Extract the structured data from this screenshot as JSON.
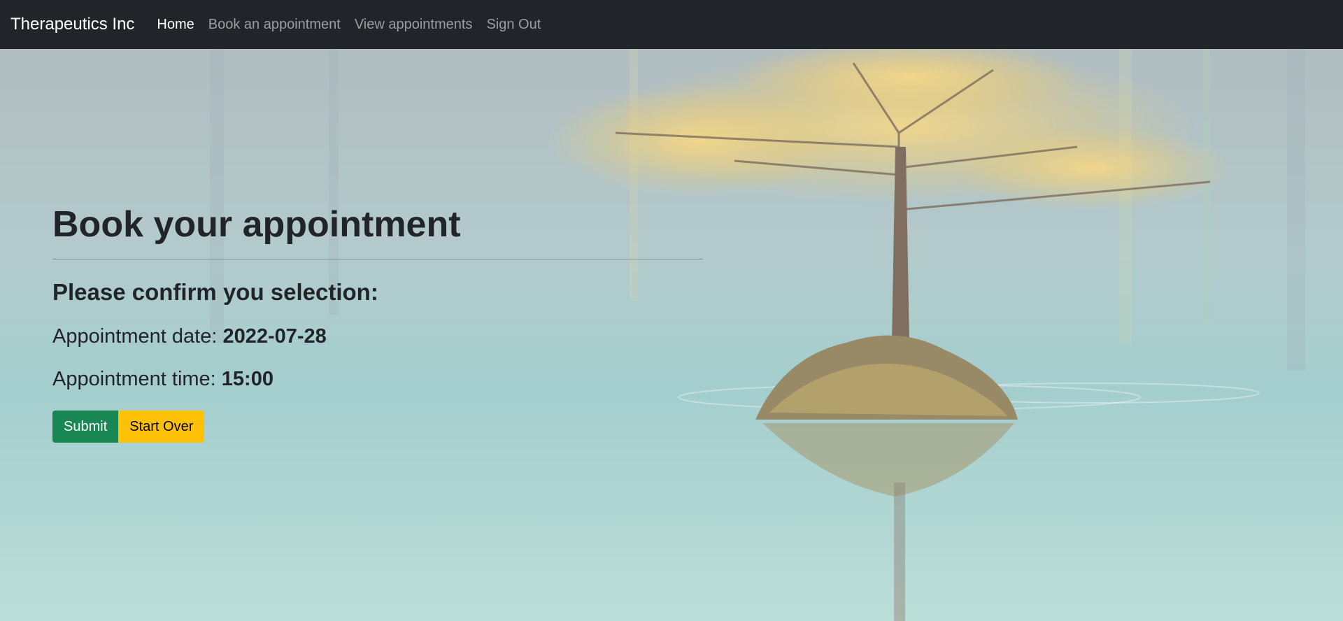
{
  "navbar": {
    "brand": "Therapeutics Inc",
    "links": [
      {
        "label": "Home",
        "active": true
      },
      {
        "label": "Book an appointment",
        "active": false
      },
      {
        "label": "View appointments",
        "active": false
      },
      {
        "label": "Sign Out",
        "active": false
      }
    ]
  },
  "page": {
    "title": "Book your appointment",
    "subtitle": "Please confirm you selection:",
    "date_label": "Appointment date: ",
    "date_value": "2022-07-28",
    "time_label": "Appointment time: ",
    "time_value": "15:00"
  },
  "buttons": {
    "submit": "Submit",
    "start_over": "Start Over"
  },
  "colors": {
    "navbar_bg": "#212529",
    "submit_bg": "#198754",
    "start_over_bg": "#ffc107"
  }
}
